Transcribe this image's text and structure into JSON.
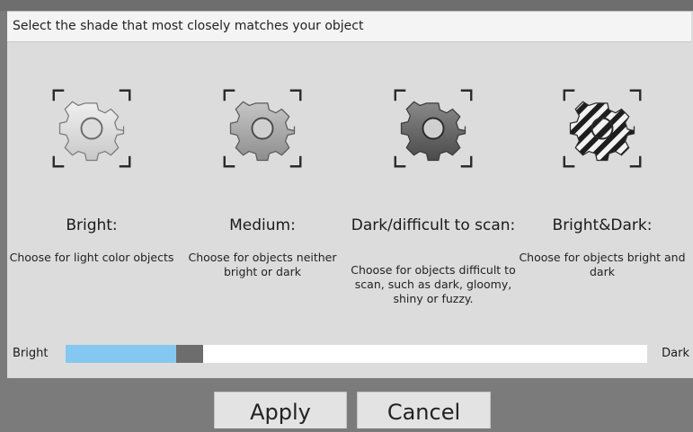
{
  "dialog": {
    "title": "Select the shade that most closely matches your object"
  },
  "options": [
    {
      "name": "Bright:",
      "description": "Choose for light color objects",
      "icon": "gear-bright-icon"
    },
    {
      "name": "Medium:",
      "description": "Choose for objects neither bright or dark",
      "icon": "gear-medium-icon"
    },
    {
      "name": "Dark/difficult to scan:",
      "description": "Choose for objects difficult to scan, such as dark, gloomy, shiny or fuzzy.",
      "icon": "gear-dark-icon"
    },
    {
      "name": "Bright&Dark:",
      "description": "Choose for objects bright and dark",
      "icon": "gear-striped-icon"
    }
  ],
  "slider": {
    "left_label": "Bright",
    "right_label": "Dark",
    "value_fraction": 0.2,
    "fill_color": "#84c7f0",
    "handle_color": "#6d6d6d"
  },
  "buttons": {
    "apply_label": "Apply",
    "cancel_label": "Cancel"
  }
}
